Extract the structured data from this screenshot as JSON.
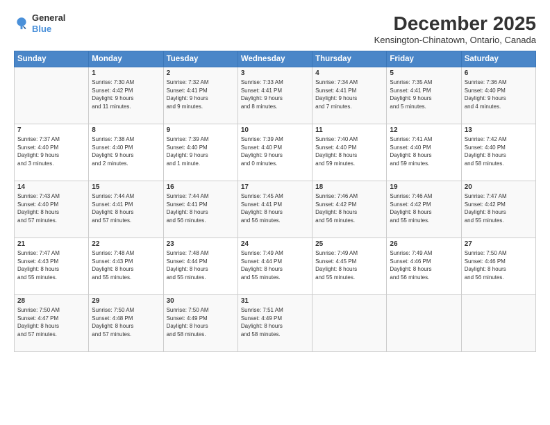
{
  "logo": {
    "general": "General",
    "blue": "Blue"
  },
  "title": "December 2025",
  "location": "Kensington-Chinatown, Ontario, Canada",
  "days_header": [
    "Sunday",
    "Monday",
    "Tuesday",
    "Wednesday",
    "Thursday",
    "Friday",
    "Saturday"
  ],
  "weeks": [
    [
      {
        "day": "",
        "info": ""
      },
      {
        "day": "1",
        "info": "Sunrise: 7:30 AM\nSunset: 4:42 PM\nDaylight: 9 hours\nand 11 minutes."
      },
      {
        "day": "2",
        "info": "Sunrise: 7:32 AM\nSunset: 4:41 PM\nDaylight: 9 hours\nand 9 minutes."
      },
      {
        "day": "3",
        "info": "Sunrise: 7:33 AM\nSunset: 4:41 PM\nDaylight: 9 hours\nand 8 minutes."
      },
      {
        "day": "4",
        "info": "Sunrise: 7:34 AM\nSunset: 4:41 PM\nDaylight: 9 hours\nand 7 minutes."
      },
      {
        "day": "5",
        "info": "Sunrise: 7:35 AM\nSunset: 4:41 PM\nDaylight: 9 hours\nand 5 minutes."
      },
      {
        "day": "6",
        "info": "Sunrise: 7:36 AM\nSunset: 4:40 PM\nDaylight: 9 hours\nand 4 minutes."
      }
    ],
    [
      {
        "day": "7",
        "info": "Sunrise: 7:37 AM\nSunset: 4:40 PM\nDaylight: 9 hours\nand 3 minutes."
      },
      {
        "day": "8",
        "info": "Sunrise: 7:38 AM\nSunset: 4:40 PM\nDaylight: 9 hours\nand 2 minutes."
      },
      {
        "day": "9",
        "info": "Sunrise: 7:39 AM\nSunset: 4:40 PM\nDaylight: 9 hours\nand 1 minute."
      },
      {
        "day": "10",
        "info": "Sunrise: 7:39 AM\nSunset: 4:40 PM\nDaylight: 9 hours\nand 0 minutes."
      },
      {
        "day": "11",
        "info": "Sunrise: 7:40 AM\nSunset: 4:40 PM\nDaylight: 8 hours\nand 59 minutes."
      },
      {
        "day": "12",
        "info": "Sunrise: 7:41 AM\nSunset: 4:40 PM\nDaylight: 8 hours\nand 59 minutes."
      },
      {
        "day": "13",
        "info": "Sunrise: 7:42 AM\nSunset: 4:40 PM\nDaylight: 8 hours\nand 58 minutes."
      }
    ],
    [
      {
        "day": "14",
        "info": "Sunrise: 7:43 AM\nSunset: 4:40 PM\nDaylight: 8 hours\nand 57 minutes."
      },
      {
        "day": "15",
        "info": "Sunrise: 7:44 AM\nSunset: 4:41 PM\nDaylight: 8 hours\nand 57 minutes."
      },
      {
        "day": "16",
        "info": "Sunrise: 7:44 AM\nSunset: 4:41 PM\nDaylight: 8 hours\nand 56 minutes."
      },
      {
        "day": "17",
        "info": "Sunrise: 7:45 AM\nSunset: 4:41 PM\nDaylight: 8 hours\nand 56 minutes."
      },
      {
        "day": "18",
        "info": "Sunrise: 7:46 AM\nSunset: 4:42 PM\nDaylight: 8 hours\nand 56 minutes."
      },
      {
        "day": "19",
        "info": "Sunrise: 7:46 AM\nSunset: 4:42 PM\nDaylight: 8 hours\nand 55 minutes."
      },
      {
        "day": "20",
        "info": "Sunrise: 7:47 AM\nSunset: 4:42 PM\nDaylight: 8 hours\nand 55 minutes."
      }
    ],
    [
      {
        "day": "21",
        "info": "Sunrise: 7:47 AM\nSunset: 4:43 PM\nDaylight: 8 hours\nand 55 minutes."
      },
      {
        "day": "22",
        "info": "Sunrise: 7:48 AM\nSunset: 4:43 PM\nDaylight: 8 hours\nand 55 minutes."
      },
      {
        "day": "23",
        "info": "Sunrise: 7:48 AM\nSunset: 4:44 PM\nDaylight: 8 hours\nand 55 minutes."
      },
      {
        "day": "24",
        "info": "Sunrise: 7:49 AM\nSunset: 4:44 PM\nDaylight: 8 hours\nand 55 minutes."
      },
      {
        "day": "25",
        "info": "Sunrise: 7:49 AM\nSunset: 4:45 PM\nDaylight: 8 hours\nand 55 minutes."
      },
      {
        "day": "26",
        "info": "Sunrise: 7:49 AM\nSunset: 4:46 PM\nDaylight: 8 hours\nand 56 minutes."
      },
      {
        "day": "27",
        "info": "Sunrise: 7:50 AM\nSunset: 4:46 PM\nDaylight: 8 hours\nand 56 minutes."
      }
    ],
    [
      {
        "day": "28",
        "info": "Sunrise: 7:50 AM\nSunset: 4:47 PM\nDaylight: 8 hours\nand 57 minutes."
      },
      {
        "day": "29",
        "info": "Sunrise: 7:50 AM\nSunset: 4:48 PM\nDaylight: 8 hours\nand 57 minutes."
      },
      {
        "day": "30",
        "info": "Sunrise: 7:50 AM\nSunset: 4:49 PM\nDaylight: 8 hours\nand 58 minutes."
      },
      {
        "day": "31",
        "info": "Sunrise: 7:51 AM\nSunset: 4:49 PM\nDaylight: 8 hours\nand 58 minutes."
      },
      {
        "day": "",
        "info": ""
      },
      {
        "day": "",
        "info": ""
      },
      {
        "day": "",
        "info": ""
      }
    ]
  ]
}
